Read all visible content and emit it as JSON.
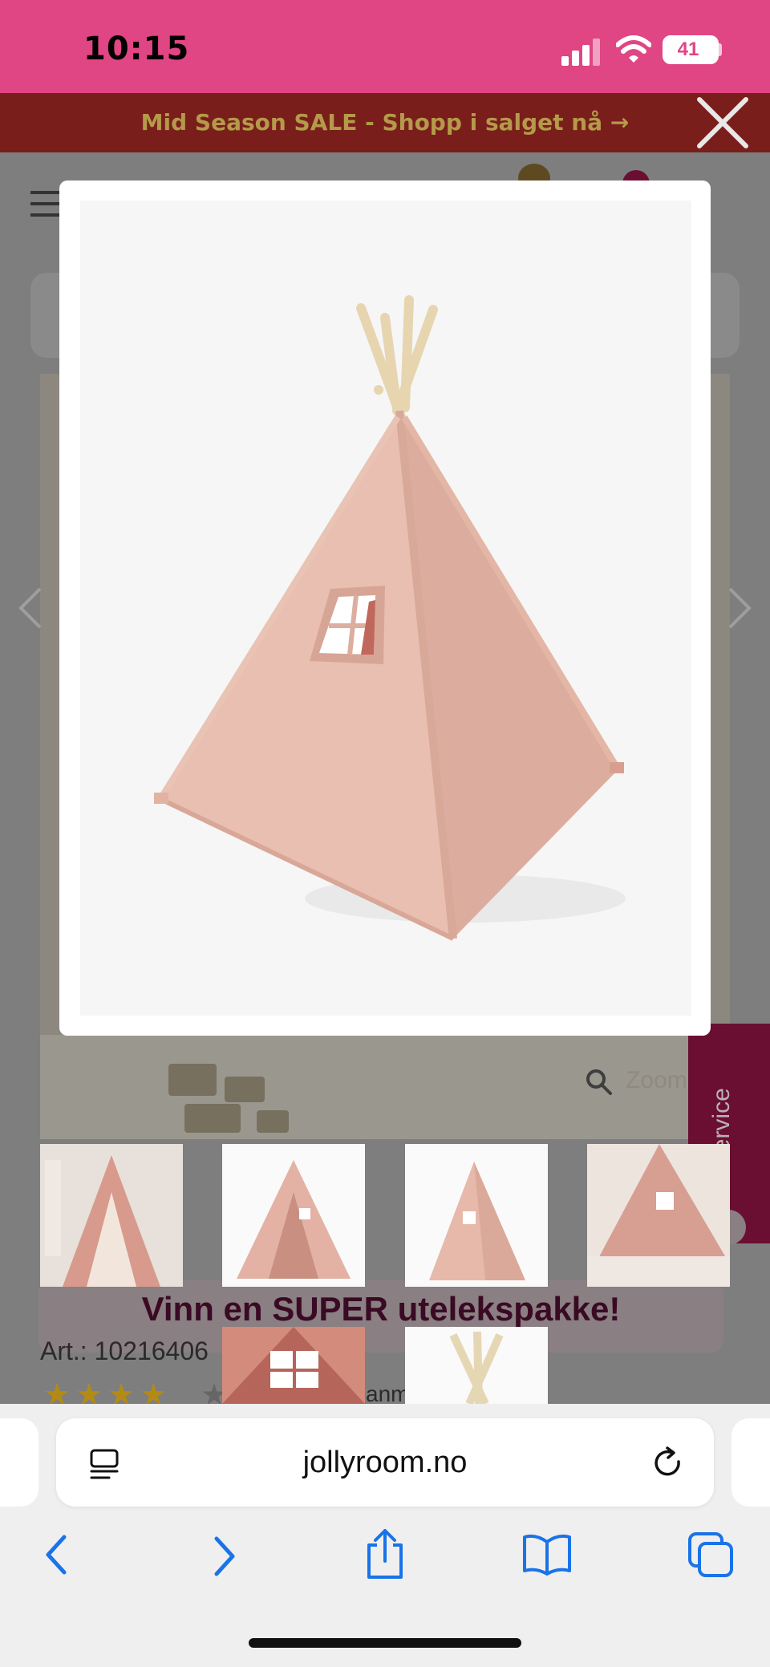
{
  "status_bar": {
    "time": "10:15",
    "battery": "41",
    "color": "#e04584"
  },
  "sale_banner": {
    "text": "Mid Season SALE - Shopp i salget nå →",
    "background": "#7a1e1c"
  },
  "background_page": {
    "zoom_label": "Zoom",
    "kundeservice_label": "Kundeservice",
    "promo_text": "Vinn en SUPER utelekspakke!",
    "article_number": "Art.: 10216406",
    "rating_stars": "★★★★",
    "reviews_label": "anm"
  },
  "modal": {
    "image_alt": "Pink teepee play tent with wooden poles and window"
  },
  "safari": {
    "url": "jollyroom.no",
    "accent": "#1a73e8"
  },
  "icons": {
    "close": "close-icon",
    "menu": "hamburger-menu-icon",
    "reader": "reader-mode-icon",
    "reload": "reload-icon",
    "back": "back-arrow-icon",
    "forward": "forward-arrow-icon",
    "share": "share-icon",
    "bookmarks": "bookmarks-icon",
    "tabs": "tabs-icon"
  }
}
